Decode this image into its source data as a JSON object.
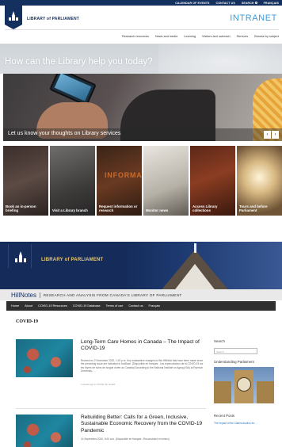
{
  "intranet": {
    "utility_links": [
      "CALENDAR OF EVENTS",
      "CONTACT US",
      "SEARCH",
      "FRANÇAIS"
    ],
    "logo_text": "LIBRARY of PARLIAMENT",
    "site_label": "INTRANET",
    "nav": [
      "Research resources",
      "News and media",
      "Learning",
      "Visitors and outreach",
      "Services",
      "Browse by subject"
    ],
    "question": "How can the Library help you today?",
    "hero_caption": "Let us know your thoughts on Library services",
    "hero_prev": "‹",
    "hero_next": "›",
    "tiles": [
      "Book an in-person briefing",
      "Visit a Library branch",
      "Request information or research",
      "Monitor news",
      "Access Library collections",
      "Tours and before Parliament"
    ],
    "tile3_image_text": "INFORMA"
  },
  "hillnotes": {
    "logo_text": "LIBRARY of PARLIAMENT",
    "blog_name": "HillNotes",
    "tagline": "RESEARCH AND ANALYSIS FROM CANADA'S LIBRARY OF PARLIAMENT",
    "nav": [
      "Home",
      "About",
      "COVID-19 Resources",
      "COVID-19 Database",
      "Terms of use",
      "Contact us",
      "Français"
    ],
    "heading": "COVID-19",
    "posts": [
      {
        "title": "Long-Term Care Homes in Canada – The Impact of COVID-19",
        "excerpt": "Revised on 2 November 2020, 1:15 p.m. Key substantive changes to this HillNote that have been made since the preceding issue are indicated in boldface. (Disponible en français : Les répercussions de la COVID-19 sur les foyers de soins de longue durée au Canada) According to the National Institute on Aging (NIA) at Ryerson University, …",
        "meta": "2 weeks ago in COVID-19, Health"
      },
      {
        "title": "Rebuilding Better: Calls for a Green, Inclusive, Sustainable Economic Recovery from the COVID-19 Pandemic",
        "excerpt": "14 September 2020, 9:00 a.m. (Disponible en français : Reconstruire en mieux)",
        "meta": ""
      }
    ],
    "sidebar": {
      "search_title": "Search",
      "search_placeholder": "Search ...",
      "understanding_title": "Understanding Parliament",
      "recent_title": "Recent Posts",
      "recent_link": "The Impact of the Claims Auction for …"
    }
  },
  "colors": {
    "navy": "#14305e",
    "intranet_blue": "#3f9bd6",
    "hn_gold": "#e8c879",
    "hn_nav": "#303030"
  }
}
